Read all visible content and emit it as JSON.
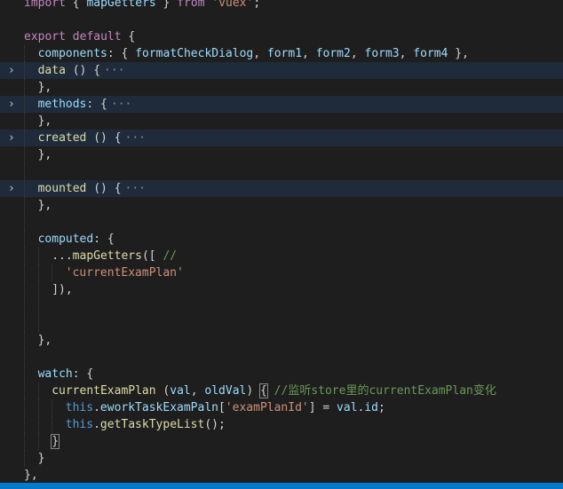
{
  "editor": {
    "lines": [
      [
        {
          "t": "import",
          "c": "kw2"
        },
        {
          "t": " { ",
          "c": "p"
        },
        {
          "t": "mapGetters",
          "c": "v"
        },
        {
          "t": " } ",
          "c": "p"
        },
        {
          "t": "from",
          "c": "kw2"
        },
        {
          "t": " ",
          "c": "p"
        },
        {
          "t": "'vuex'",
          "c": "s"
        },
        {
          "t": ";",
          "c": "p"
        }
      ],
      [],
      [
        {
          "t": "export",
          "c": "kw2"
        },
        {
          "t": " ",
          "c": "p"
        },
        {
          "t": "default",
          "c": "kw2"
        },
        {
          "t": " {",
          "c": "p"
        }
      ],
      [
        {
          "t": "components",
          "c": "v"
        },
        {
          "t": ": { ",
          "c": "p"
        },
        {
          "t": "formatCheckDialog",
          "c": "v"
        },
        {
          "t": ", ",
          "c": "p"
        },
        {
          "t": "form1",
          "c": "v"
        },
        {
          "t": ", ",
          "c": "p"
        },
        {
          "t": "form2",
          "c": "v"
        },
        {
          "t": ", ",
          "c": "p"
        },
        {
          "t": "form3",
          "c": "v"
        },
        {
          "t": ", ",
          "c": "p"
        },
        {
          "t": "form4",
          "c": "v"
        },
        {
          "t": " },",
          "c": "p"
        }
      ],
      [
        {
          "t": "data",
          "c": "f"
        },
        {
          "t": " () {",
          "c": "p"
        }
      ],
      [
        {
          "t": "},",
          "c": "p"
        }
      ],
      [
        {
          "t": "methods",
          "c": "v"
        },
        {
          "t": ": {",
          "c": "p"
        }
      ],
      [
        {
          "t": "},",
          "c": "p"
        }
      ],
      [
        {
          "t": "created",
          "c": "f"
        },
        {
          "t": " () {",
          "c": "p"
        }
      ],
      [
        {
          "t": "},",
          "c": "p"
        }
      ],
      [],
      [
        {
          "t": "mounted",
          "c": "f"
        },
        {
          "t": " () {",
          "c": "p"
        }
      ],
      [
        {
          "t": "},",
          "c": "p"
        }
      ],
      [],
      [
        {
          "t": "computed",
          "c": "v"
        },
        {
          "t": ": {",
          "c": "p"
        }
      ],
      [
        {
          "t": "...",
          "c": "p"
        },
        {
          "t": "mapGetters",
          "c": "f"
        },
        {
          "t": "([ ",
          "c": "p"
        },
        {
          "t": "//",
          "c": "c"
        }
      ],
      [
        {
          "t": "'currentExamPlan'",
          "c": "s"
        }
      ],
      [
        {
          "t": "]),",
          "c": "p"
        }
      ],
      [],
      [],
      [
        {
          "t": "},",
          "c": "p"
        }
      ],
      [],
      [
        {
          "t": "watch",
          "c": "v"
        },
        {
          "t": ": {",
          "c": "p"
        }
      ],
      [
        {
          "t": "currentExamPlan",
          "c": "f"
        },
        {
          "t": " (",
          "c": "p"
        },
        {
          "t": "val",
          "c": "v"
        },
        {
          "t": ", ",
          "c": "p"
        },
        {
          "t": "oldVal",
          "c": "v"
        },
        {
          "t": ") ",
          "c": "p"
        },
        {
          "t": "{",
          "c": "p",
          "box": true
        },
        {
          "t": " //监听store里的currentExamPlan变化",
          "c": "c"
        }
      ],
      [
        {
          "t": "this",
          "c": "k"
        },
        {
          "t": ".",
          "c": "p"
        },
        {
          "t": "eworkTaskExamPaln",
          "c": "v"
        },
        {
          "t": "[",
          "c": "p"
        },
        {
          "t": "'examPlanId'",
          "c": "s"
        },
        {
          "t": "] = ",
          "c": "p"
        },
        {
          "t": "val",
          "c": "v"
        },
        {
          "t": ".",
          "c": "p"
        },
        {
          "t": "id",
          "c": "v"
        },
        {
          "t": ";",
          "c": "p"
        }
      ],
      [
        {
          "t": "this",
          "c": "k"
        },
        {
          "t": ".",
          "c": "p"
        },
        {
          "t": "getTaskTypeList",
          "c": "f"
        },
        {
          "t": "();",
          "c": "p"
        }
      ],
      [
        {
          "t": "}",
          "c": "p",
          "box": true
        }
      ],
      [
        {
          "t": "}",
          "c": "p"
        }
      ],
      [
        {
          "t": "},",
          "c": "p"
        }
      ]
    ],
    "indents": [
      0,
      0,
      0,
      1,
      1,
      1,
      1,
      1,
      1,
      1,
      1,
      1,
      1,
      1,
      1,
      2,
      3,
      2,
      2,
      2,
      1,
      1,
      1,
      2,
      3,
      3,
      2,
      1,
      0
    ],
    "guides": [
      0,
      0,
      0,
      1,
      1,
      1,
      1,
      1,
      1,
      1,
      1,
      1,
      1,
      1,
      1,
      2,
      3,
      2,
      2,
      2,
      1,
      1,
      1,
      2,
      3,
      3,
      2,
      1,
      0
    ],
    "folded": [
      4,
      6,
      8,
      11
    ],
    "fold_icon": "chevron-right-icon",
    "fold_glyph": "›",
    "ellipsis": "···"
  }
}
